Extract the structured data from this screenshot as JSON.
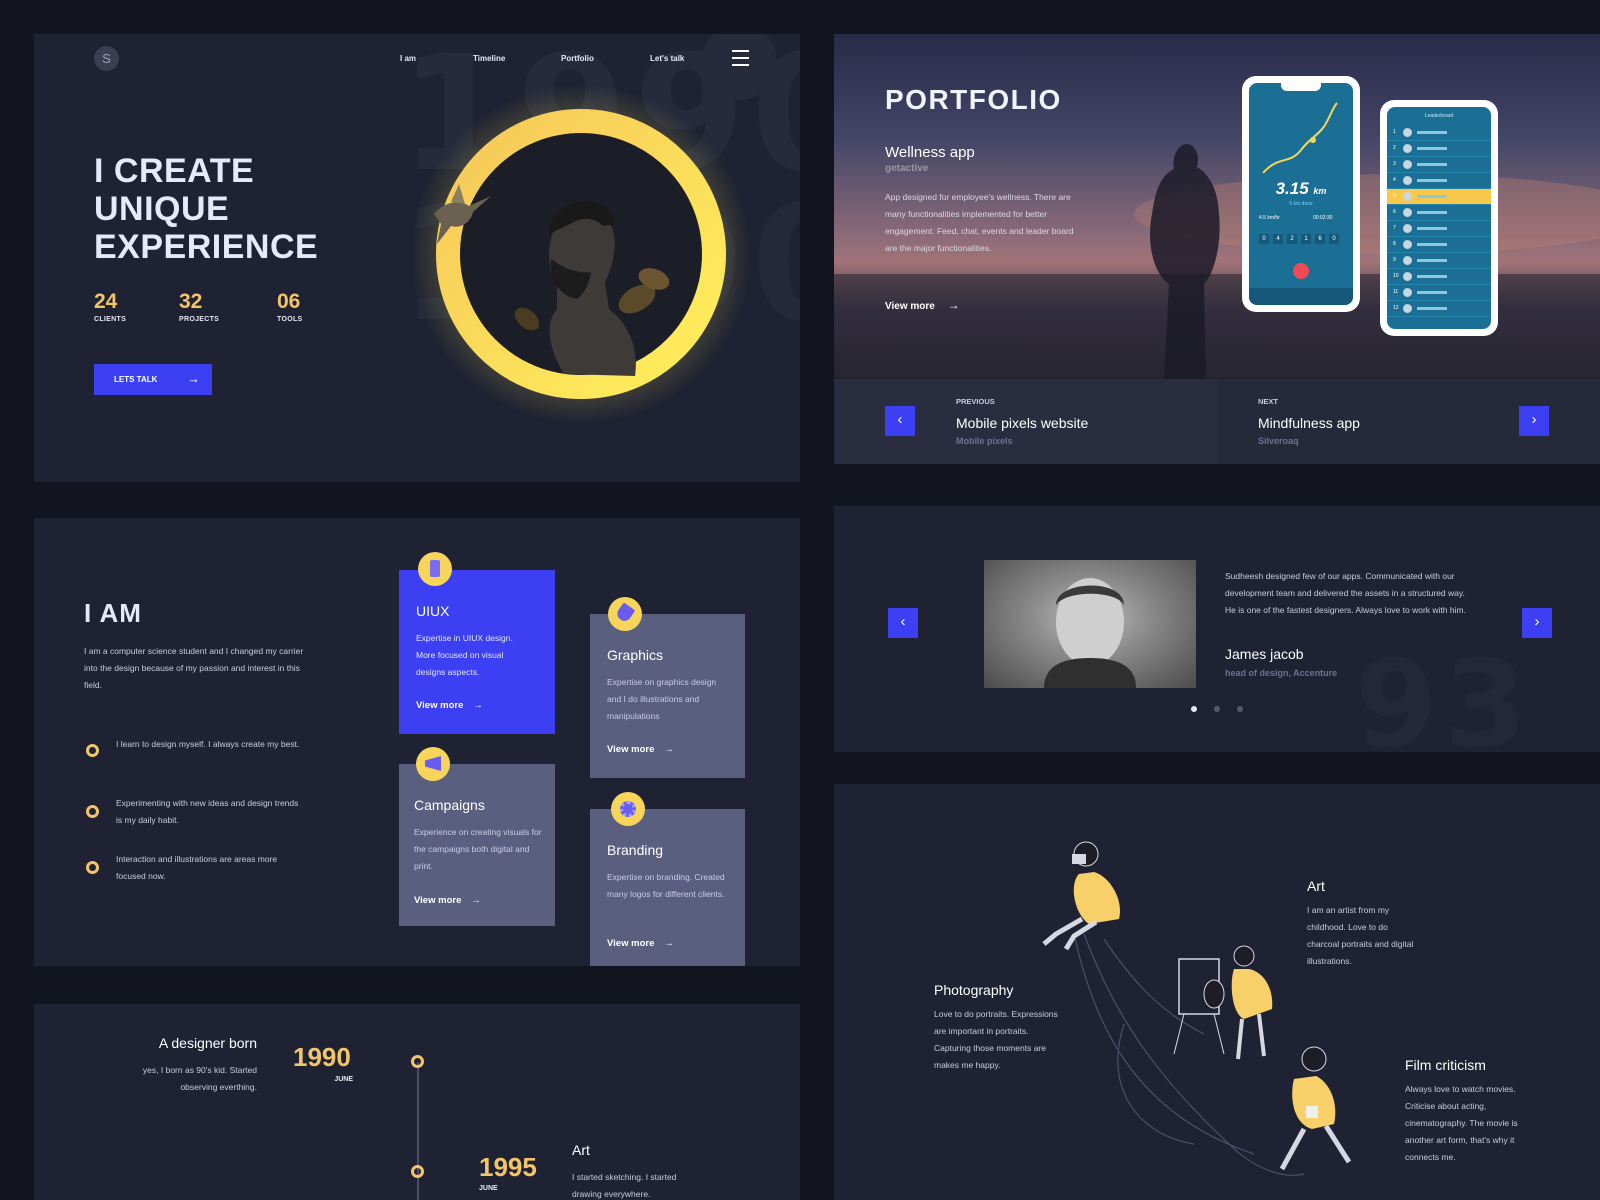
{
  "hero": {
    "logo": "S",
    "bg_digits": "1990",
    "nav": [
      "I am",
      "Timeline",
      "Portfolio",
      "Let's talk"
    ],
    "title": "I CREATE UNIQUE EXPERIENCE",
    "stats": [
      {
        "value": "24",
        "label": "CLIENTS"
      },
      {
        "value": "32",
        "label": "PROJECTS"
      },
      {
        "value": "06",
        "label": "TOOLS"
      }
    ],
    "cta_label": "LETS TALK"
  },
  "portfolio": {
    "heading": "PORTFOLIO",
    "project_title": "Wellness app",
    "project_client": "getactive",
    "project_desc": "App designed for employee's wellness. There are many functionalities implemented for better engagement. Feed, chat, events and leader board are the major functionalities.",
    "view_more": "View more",
    "phone": {
      "distance": "3.15",
      "unit": "km",
      "distance_sub": "5 km done",
      "speed": "4.5 km/hr",
      "duration": "00:02:30",
      "counter": [
        "0",
        "4",
        "2",
        "1",
        "6",
        "0"
      ],
      "leaderboard_title": "Leaderboard",
      "leaderboard_rows": [
        "1",
        "2",
        "3",
        "4",
        "5",
        "6",
        "7",
        "8",
        "9",
        "10",
        "11",
        "12"
      ]
    },
    "previous": {
      "label": "PREVIOUS",
      "title": "Mobile pixels website",
      "subtitle": "Mobile pixels"
    },
    "next": {
      "label": "NEXT",
      "title": "Mindfulness app",
      "subtitle": "Silveroaq"
    }
  },
  "testimonial": {
    "quote": "Sudheesh designed few of our apps. Communicated with our development team and delivered the assets in a structured way. He is one of the fastest designers. Always love to work with him.",
    "name": "James jacob",
    "role": "head of design, Accenture",
    "dots": 3,
    "active_dot": 0
  },
  "iam": {
    "heading": "I AM",
    "intro": "I am a computer science student and I changed my carrier into the design because of my passion and interest in this field.",
    "bullets": [
      "I learn to design myself. I always create my best.",
      "Experimenting with new ideas and design trends is my daily habit.",
      "Interaction and illustrations are areas more focused now."
    ],
    "cards": [
      {
        "title": "UIUX",
        "desc": "Expertise in UIUX design. More focused on visual designs aspects.",
        "link": "View more",
        "icon": "phone-icon"
      },
      {
        "title": "Graphics",
        "desc": "Expertise on graphics design and I do illustrations and manipulations",
        "link": "View more",
        "icon": "pen-icon"
      },
      {
        "title": "Campaigns",
        "desc": "Experience on creating visuals for the campaigns both digital and print.",
        "link": "View more",
        "icon": "megaphone-icon"
      },
      {
        "title": "Branding",
        "desc": "Expertise on branding. Created many logos for different clients.",
        "link": "View more",
        "icon": "badge-icon"
      }
    ]
  },
  "timeline": {
    "events": [
      {
        "title": "A designer born",
        "desc": "yes, I born as 90's kid. Started observing everthing.",
        "year": "1990",
        "month": "JUNE"
      },
      {
        "title": "Art",
        "desc": "I started sketching. I started drawing everywhere.",
        "year": "1995",
        "month": "JUNE"
      }
    ]
  },
  "hobbies": {
    "items": [
      {
        "title": "Art",
        "desc": "I am an artist from my childhood. Love to do charcoal portraits and digital illustrations."
      },
      {
        "title": "Photography",
        "desc": "Love to do portraits. Expressions are important in portraits. Capturing those moments are makes me happy."
      },
      {
        "title": "Film criticism",
        "desc": "Always love to watch movies. Criticise about acting, cinematography. The movie is another art form, that's why it connects me."
      }
    ]
  },
  "colors": {
    "page_bg": "#121520",
    "panel_bg": "#1f2232",
    "accent_blue": "#3c3ff2",
    "accent_yellow": "#f3c56a",
    "card_grey": "#5a5f80"
  }
}
